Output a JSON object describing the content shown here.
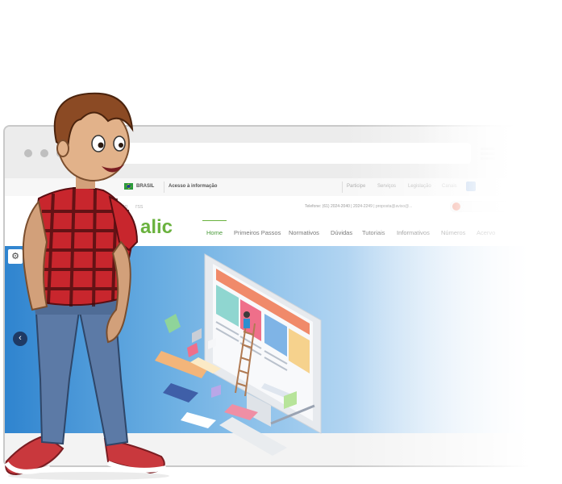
{
  "gov_bar": {
    "country": "BRASIL",
    "info_link": "Acesso à informação",
    "links": [
      "Participe",
      "Serviços",
      "Legislação",
      "Canais"
    ]
  },
  "contact": {
    "phone": "Telefone: (61) 2024-2040 | 2024-2249 | proposta@aviso@...",
    "social": [
      "in",
      "rss"
    ]
  },
  "logo": {
    "text": "alic"
  },
  "nav": {
    "items": [
      "Home",
      "Primeiros Passos",
      "Normativos",
      "Dúvidas",
      "Tutoriais",
      "Informativos",
      "Números",
      "Acervo"
    ],
    "active": "Home"
  },
  "hero": {
    "prev_icon": "chevron-left-icon",
    "settings_icon": "gear-icon"
  },
  "colors": {
    "brand_green": "#6ab23e",
    "hero_blue": "#2f84cf",
    "nav_dark": "#1f3a64"
  }
}
